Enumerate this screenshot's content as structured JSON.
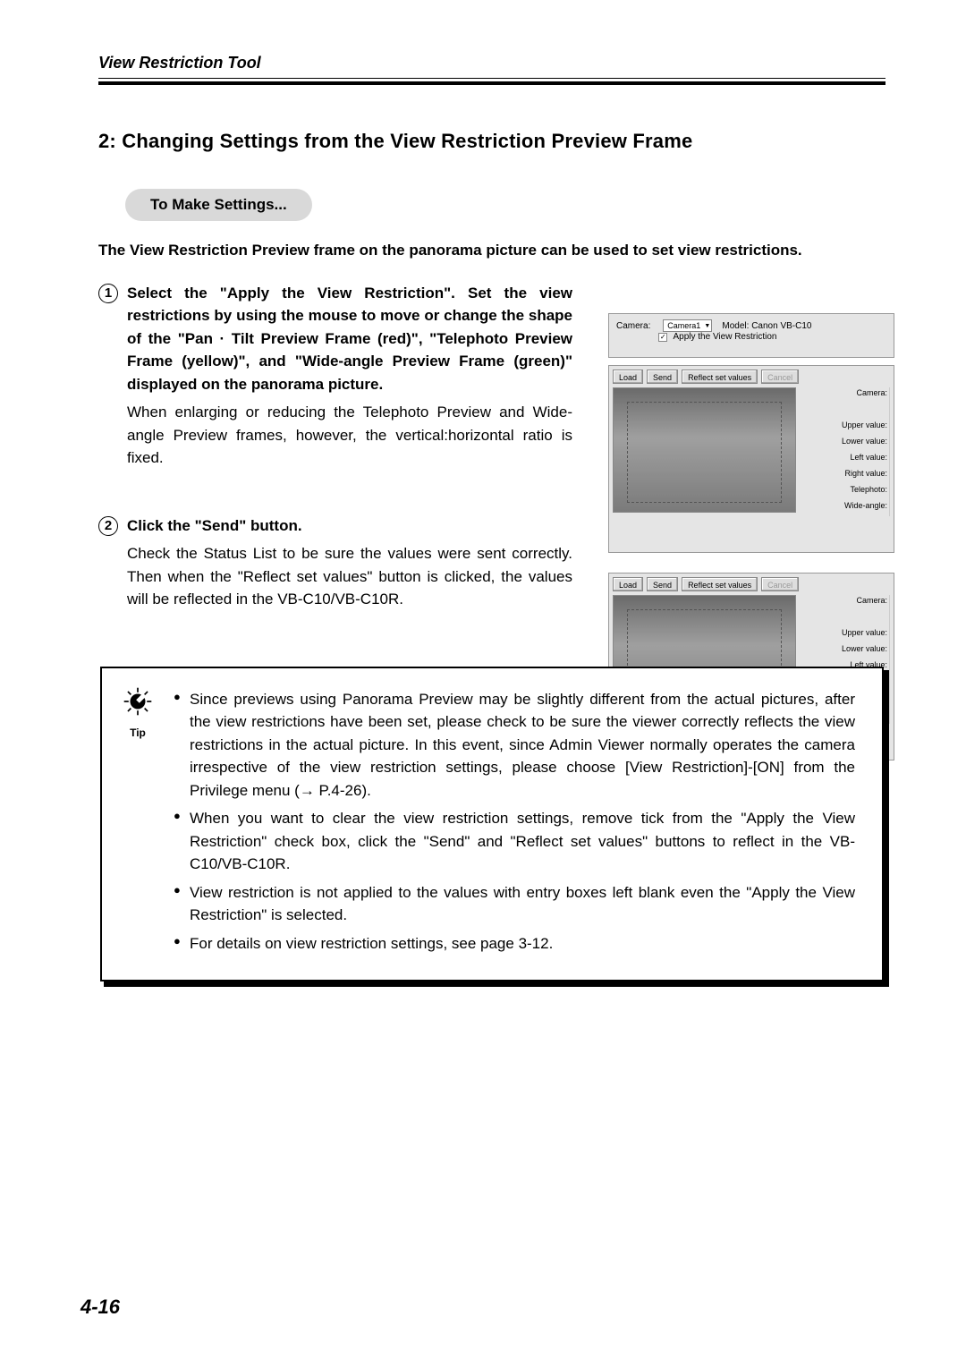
{
  "header": {
    "title": "View Restriction Tool"
  },
  "section_title": "2: Changing Settings from the View Restriction Preview Frame",
  "pill": "To Make Settings...",
  "intro": "The View Restriction Preview frame on the panorama picture can be used to set view restrictions.",
  "step1": {
    "num": "1",
    "bold": "Select the \"Apply the View Restriction\". Set the view restrictions by using the mouse to move or change the shape of the \"Pan · Tilt Preview Frame (red)\", \"Telephoto Preview Frame (yellow)\", and \"Wide-angle Preview Frame (green)\" displayed on the panorama picture.",
    "body": "When enlarging or reducing the Telephoto Preview and Wide-angle Preview frames, however, the vertical:horizontal ratio is fixed."
  },
  "step2": {
    "num": "2",
    "bold": "Click the \"Send\" button.",
    "body": "Check the Status List to be sure the values were sent correctly. Then when the \"Reflect set values\" button is clicked, the values will be reflected in the VB-C10/VB-C10R."
  },
  "fig_top": {
    "camera_label": "Camera:",
    "camera_value": "Camera1",
    "model_label": "Model:",
    "model_value": "Canon VB-C10",
    "apply": "Apply the View Restriction"
  },
  "fig_mid": {
    "load": "Load",
    "send": "Send",
    "reflect": "Reflect set values",
    "cancel": "Cancel",
    "side": {
      "camera": "Camera:",
      "upper": "Upper value:",
      "lower": "Lower value:",
      "left": "Left value:",
      "right": "Right value:",
      "tele": "Telephoto:",
      "wide": "Wide-angle:"
    }
  },
  "tip": {
    "label": "Tip",
    "items": [
      "Since previews using Panorama Preview may be slightly different from the actual pictures, after the view restrictions have been set, please check to be sure the viewer correctly reflects the view restrictions in the actual picture. In this event, since Admin Viewer normally operates the camera irrespective of the view restriction settings, please choose [View Restriction]-[ON] from the Privilege menu (→ P.4-26).",
      "When you want to clear the view restriction settings, remove tick from the \"Apply the View Restriction\" check box, click the \"Send\" and \"Reflect set values\" buttons to reflect in the VB-C10/VB-C10R.",
      "View restriction is not applied to the values with entry boxes left blank even the \"Apply the View Restriction\" is selected.",
      "For details on view restriction settings, see page 3-12."
    ]
  },
  "page_num": "4-16"
}
